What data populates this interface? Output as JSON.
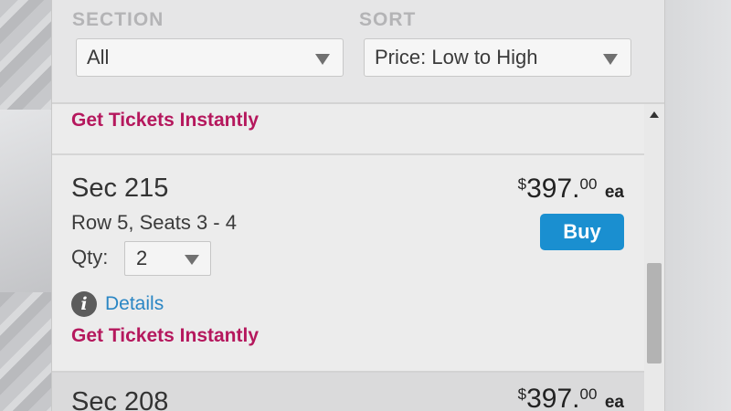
{
  "filters": {
    "section_label": "SECTION",
    "section_value": "All",
    "sort_label": "SORT",
    "sort_value": "Price: Low to High"
  },
  "listings": [
    {
      "instant_label": "Get Tickets Instantly"
    },
    {
      "section": "Sec 215",
      "row_seats": "Row 5, Seats 3 - 4",
      "qty_label": "Qty:",
      "qty_value": "2",
      "details_label": "Details",
      "instant_label": "Get Tickets Instantly",
      "price_currency": "$",
      "price_whole": "397.",
      "price_cents": "00",
      "price_unit": "ea",
      "buy_label": "Buy"
    },
    {
      "section": "Sec 208",
      "price_currency": "$",
      "price_whole": "397.",
      "price_cents": "00",
      "price_unit": "ea"
    }
  ],
  "colors": {
    "accent_magenta": "#b5185d",
    "buy_blue": "#1a8fd0",
    "link_blue": "#2a86c4"
  },
  "icons": {
    "info": "info-icon",
    "dropdown": "chevron-down-icon",
    "scroll_up": "scroll-up-arrow-icon"
  }
}
